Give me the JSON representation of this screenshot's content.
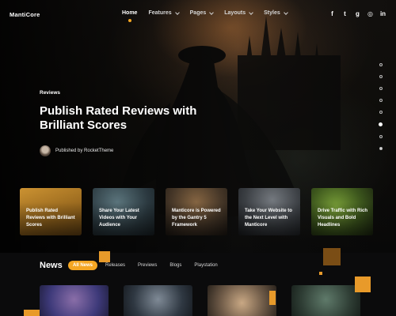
{
  "brand": {
    "logo": "MantiCore"
  },
  "nav": {
    "items": [
      {
        "label": "Home",
        "active": true,
        "dropdown": false
      },
      {
        "label": "Features",
        "active": false,
        "dropdown": true
      },
      {
        "label": "Pages",
        "active": false,
        "dropdown": true
      },
      {
        "label": "Layouts",
        "active": false,
        "dropdown": true
      },
      {
        "label": "Styles",
        "active": false,
        "dropdown": true
      }
    ],
    "social": [
      {
        "icon": "facebook-icon",
        "glyph": "f"
      },
      {
        "icon": "twitter-icon",
        "glyph": "t"
      },
      {
        "icon": "github-icon",
        "glyph": "g"
      },
      {
        "icon": "instagram-icon",
        "glyph": "◎"
      },
      {
        "icon": "linkedin-icon",
        "glyph": "in"
      }
    ]
  },
  "hero": {
    "label": "Reviews",
    "title": "Publish Rated Reviews with Brilliant Scores",
    "author": "Published by RocketTheme",
    "slide_dots": 8,
    "active_dot": 5
  },
  "cards": [
    {
      "text": "Publish Rated Reviews with Brilliant Scores"
    },
    {
      "text": "Share Your Latest Videos with Your Audience"
    },
    {
      "text": "Manticore is Powered by the Gantry 5 Framework"
    },
    {
      "text": "Take Your Website to the Next Level with Manticore"
    },
    {
      "text": "Drive Traffic with Rich Visuals and Bold Headlines"
    }
  ],
  "news": {
    "title": "News",
    "tabs": [
      "All News",
      "Releases",
      "Previews",
      "Blogs",
      "Playstation"
    ],
    "active_tab": 0
  },
  "colors": {
    "accent": "#f5a623",
    "background": "#0b0b0c"
  }
}
